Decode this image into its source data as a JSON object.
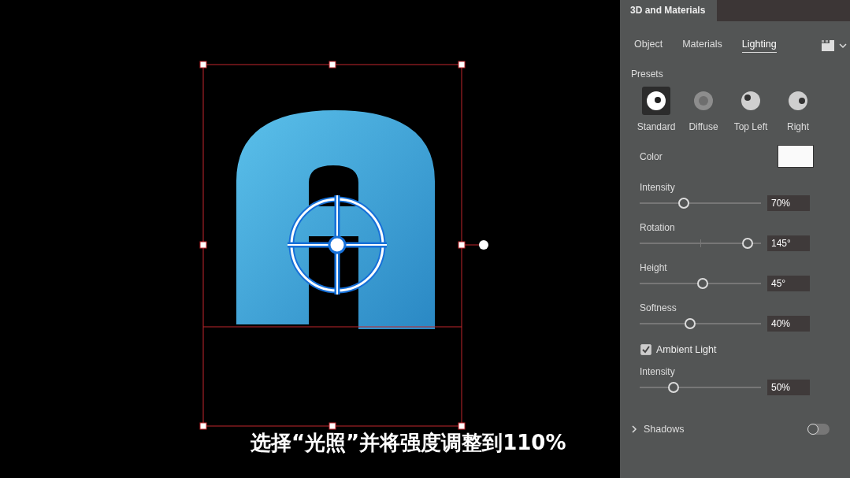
{
  "canvas": {
    "caption": "选择“光照”并将强度调整到110%"
  },
  "panel": {
    "title": "3D and Materials",
    "tabs": [
      {
        "label": "Object",
        "selected": false
      },
      {
        "label": "Materials",
        "selected": false
      },
      {
        "label": "Lighting",
        "selected": true
      }
    ],
    "presets_label": "Presets",
    "presets": [
      {
        "label": "Standard",
        "kind": "standard",
        "selected": true
      },
      {
        "label": "Diffuse",
        "kind": "diffuse",
        "selected": false
      },
      {
        "label": "Top Left",
        "kind": "top_left",
        "selected": false
      },
      {
        "label": "Right",
        "kind": "right",
        "selected": false
      }
    ],
    "color_label": "Color",
    "sliders": [
      {
        "label": "Intensity",
        "kind": "plain",
        "level": 0.36,
        "reading": "70%"
      },
      {
        "label": "Rotation",
        "kind": "centered",
        "level": 0.88,
        "reading": "145°"
      },
      {
        "label": "Height",
        "kind": "plain",
        "level": 0.51,
        "reading": "45°"
      },
      {
        "label": "Softness",
        "kind": "plain",
        "level": 0.41,
        "reading": "40%"
      }
    ],
    "ambient": {
      "label": "Ambient Light",
      "checked": true,
      "slider": {
        "label": "Intensity",
        "level": 0.27,
        "reading": "50%"
      }
    },
    "shadows": {
      "label": "Shadows",
      "expanded": false,
      "on": false
    }
  }
}
